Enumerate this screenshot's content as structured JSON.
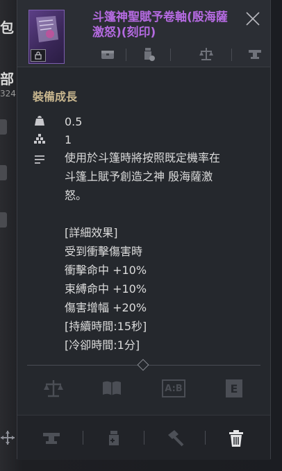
{
  "background": {
    "label_top": "包",
    "label_mid": "部",
    "number": "324"
  },
  "item": {
    "name": "斗篷神聖賦予卷軸(殷海薩激怒)(刻印)",
    "icon": "scroll-icon",
    "lock": "lock-icon"
  },
  "header_icons": [
    "chest-icon",
    "potion-icon",
    "scale-icon",
    "anvil-icon"
  ],
  "section": {
    "title": "裝備成長"
  },
  "stats": [
    {
      "icon": "weight-icon",
      "value": "0.5"
    },
    {
      "icon": "stack-icon",
      "value": "1"
    }
  ],
  "description_lines": [
    "使用於斗篷時將按照既定機率在",
    "斗篷上賦予創造之神 殷海薩激",
    "怒。",
    "",
    "[詳細效果]",
    "受到衝擊傷害時",
    "衝擊命中 +10%",
    "束縛命中 +10%",
    "傷害增幅 +20%",
    "[持續時間:15秒]",
    "[冷卻時間:1分]"
  ],
  "actions": {
    "row1": [
      "balance-icon",
      "book-icon",
      "compare-icon",
      "equip-icon"
    ],
    "compare_label": "A:B",
    "equip_label": "E",
    "footer": [
      "anvil-icon",
      "potion-icon",
      "hammer-icon",
      "trash-icon"
    ]
  },
  "colors": {
    "item_name": "#b46ae0",
    "section_title": "#c9b78f",
    "text": "#dcdcdc",
    "panel": "#25282d"
  }
}
